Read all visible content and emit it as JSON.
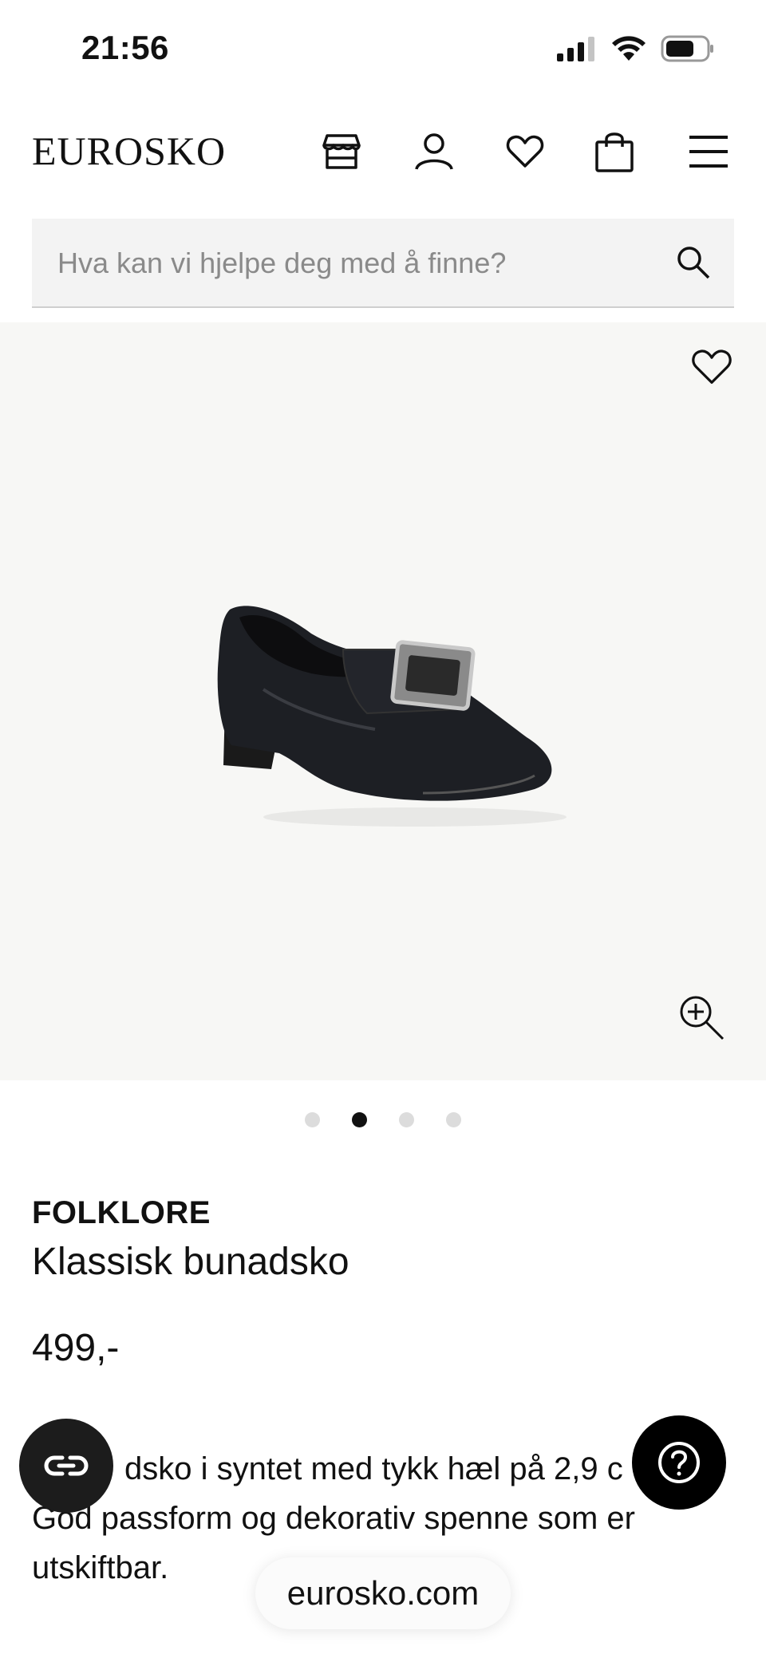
{
  "status_bar": {
    "time": "21:56",
    "icons": [
      "cellular-signal-icon",
      "wifi-icon",
      "battery-icon"
    ]
  },
  "header": {
    "logo": "EUROSKO",
    "icons": [
      "store-icon",
      "user-icon",
      "heart-icon",
      "shopping-bag-icon",
      "menu-icon"
    ]
  },
  "search": {
    "placeholder": "Hva kan vi hjelpe deg med å finne?",
    "value": ""
  },
  "gallery": {
    "image": "black-leather-bunad-shoe-with-silver-buckle",
    "total_images": 4,
    "active_index": 2,
    "icons": [
      "heart-outline-icon",
      "zoom-in-icon"
    ]
  },
  "product": {
    "brand": "FOLKLORE",
    "name": "Klassisk bunadsko",
    "price": "499,-",
    "description_visible": "dsko i syntet med tykk hæl på 2,9 c",
    "description_line2": "God passform og dekorativ spenne som er",
    "description_line3": "utskiftbar."
  },
  "floating": {
    "left_button_icon": "link-icon",
    "right_button_icon": "help-question-icon"
  },
  "browser": {
    "url": "eurosko.com"
  },
  "colors": {
    "text": "#111111",
    "gallery_bg": "#f7f7f5",
    "search_bg": "#f3f3f3",
    "dot_active": "#111111",
    "dot_inactive": "#dcdcdc"
  }
}
